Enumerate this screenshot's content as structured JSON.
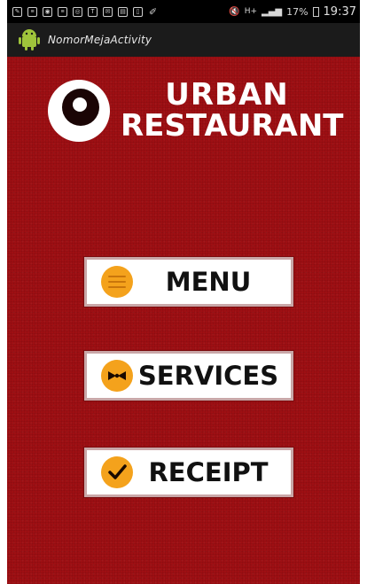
{
  "status_bar": {
    "battery": "17%",
    "time": "19:37"
  },
  "action_bar": {
    "title": "NomorMejaActivity"
  },
  "logo": {
    "line1": "URBAN",
    "line2": "RESTAURANT"
  },
  "buttons": [
    {
      "label": "MENU",
      "icon": "menu-lines-icon"
    },
    {
      "label": "SERVICES",
      "icon": "bowtie-icon"
    },
    {
      "label": "RECEIPT",
      "icon": "checkmark-icon"
    }
  ],
  "colors": {
    "background": "#9e0f13",
    "button_icon": "#f4a21c",
    "button_bg": "#ffffff"
  }
}
